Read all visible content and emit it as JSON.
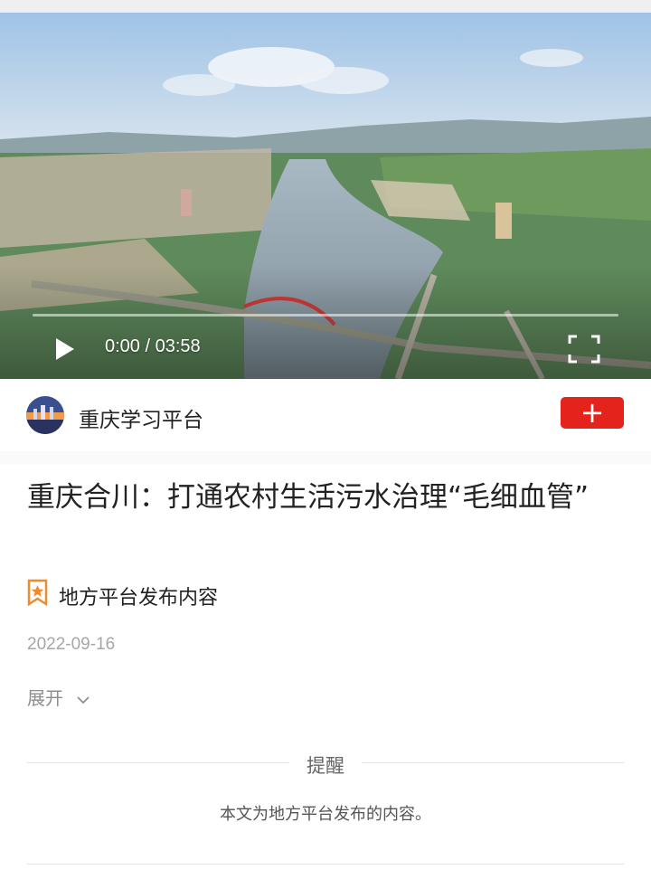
{
  "video": {
    "time_display": "0:00 / 03:58",
    "progress_fraction": 0.0
  },
  "channel": {
    "name": "重庆学习平台",
    "follow_label": "+"
  },
  "article": {
    "title": "重庆合川：打通农村生活污水治理“毛细血管”",
    "source_label": "地方平台发布内容",
    "date": "2022-09-16",
    "expand_label": "展开"
  },
  "notice": {
    "title": "提醒",
    "text": "本文为地方平台发布的内容。"
  },
  "colors": {
    "follow_button": "#e5231d",
    "source_icon": "#f08a2a"
  }
}
